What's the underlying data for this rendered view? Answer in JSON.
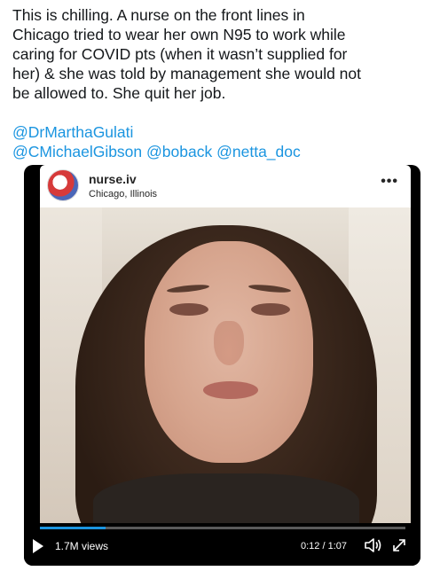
{
  "tweet": {
    "text": "This is chilling. A nurse on the front lines in\nChicago tried to wear her own N95 to work while\ncaring for COVID pts (when it wasn’t supplied for\nher) & she was told by management she would not\nbe allowed to. She quit her job.",
    "mentions": [
      "@DrMarthaGulati",
      "@CMichaelGibson",
      "@boback",
      "@netta_doc"
    ]
  },
  "instagram_post": {
    "username": "nurse.iv",
    "location": "Chicago, Illinois",
    "more_label": "•••"
  },
  "video": {
    "views_label": "1.7M views",
    "time_label": "0:12 / 1:07",
    "progress_fraction": 0.18
  },
  "icons": {
    "play": "play-icon",
    "volume": "volume-icon",
    "expand": "expand-icon",
    "avatar": "avatar"
  },
  "colors": {
    "link": "#1b95e0",
    "text": "#14171a",
    "video_bg": "#000000"
  }
}
